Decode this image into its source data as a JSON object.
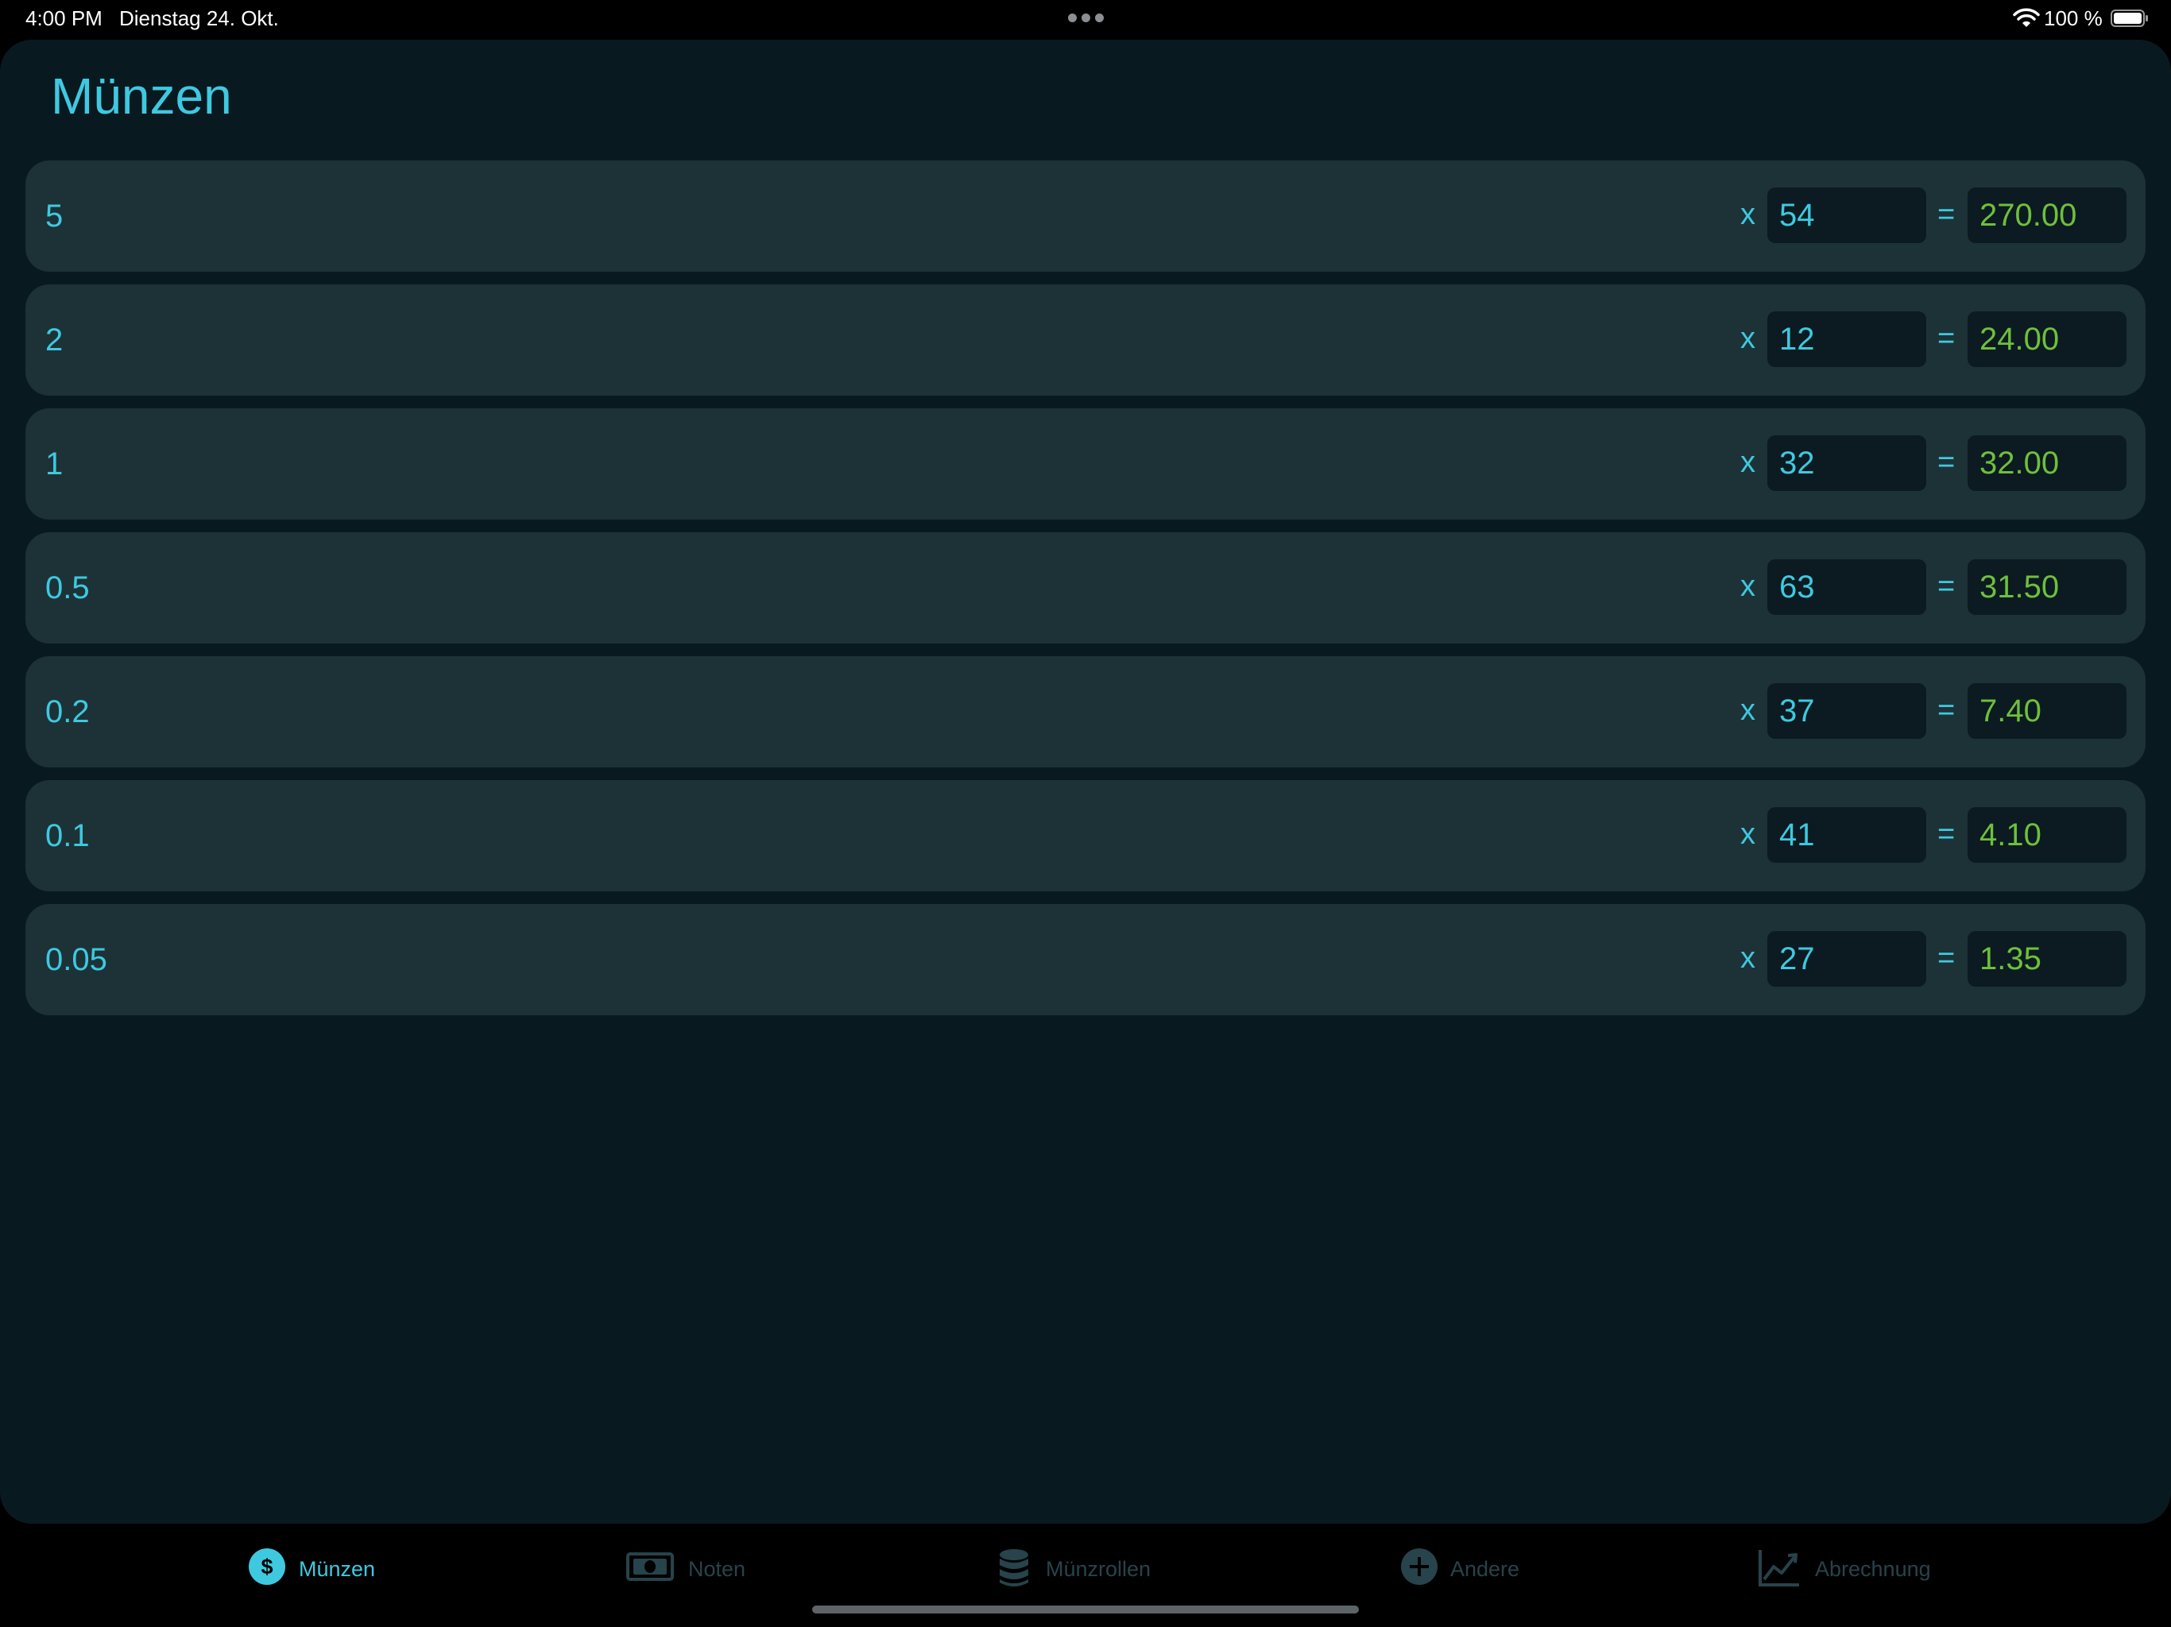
{
  "status_bar": {
    "time": "4:00 PM",
    "date": "Dienstag 24. Okt.",
    "battery": "100 %",
    "icons": [
      "multitasking-dots-icon",
      "wifi-icon",
      "battery-icon"
    ]
  },
  "page": {
    "title": "Münzen"
  },
  "rows": [
    {
      "denomination": "5",
      "multiply": "x",
      "quantity": "54",
      "equals": "=",
      "total": "270.00"
    },
    {
      "denomination": "2",
      "multiply": "x",
      "quantity": "12",
      "equals": "=",
      "total": "24.00"
    },
    {
      "denomination": "1",
      "multiply": "x",
      "quantity": "32",
      "equals": "=",
      "total": "32.00"
    },
    {
      "denomination": "0.5",
      "multiply": "x",
      "quantity": "63",
      "equals": "=",
      "total": "31.50"
    },
    {
      "denomination": "0.2",
      "multiply": "x",
      "quantity": "37",
      "equals": "=",
      "total": "7.40"
    },
    {
      "denomination": "0.1",
      "multiply": "x",
      "quantity": "41",
      "equals": "=",
      "total": "4.10"
    },
    {
      "denomination": "0.05",
      "multiply": "x",
      "quantity": "27",
      "equals": "=",
      "total": "1.35"
    }
  ],
  "tabs": [
    {
      "label": "Münzen",
      "icon": "dollar-coin-icon",
      "active": true
    },
    {
      "label": "Noten",
      "icon": "banknote-icon",
      "active": false
    },
    {
      "label": "Münzrollen",
      "icon": "coin-roll-icon",
      "active": false
    },
    {
      "label": "Andere",
      "icon": "plus-circle-icon",
      "active": false
    },
    {
      "label": "Abrechnung",
      "icon": "chart-line-icon",
      "active": false
    }
  ],
  "colors": {
    "accent": "#3ec9e0",
    "total_text": "#6fbf3c",
    "sheet_background": "#091920",
    "row_background": "#1d3237",
    "field_background": "#0b1b21",
    "inactive_tab": "#27434b"
  }
}
